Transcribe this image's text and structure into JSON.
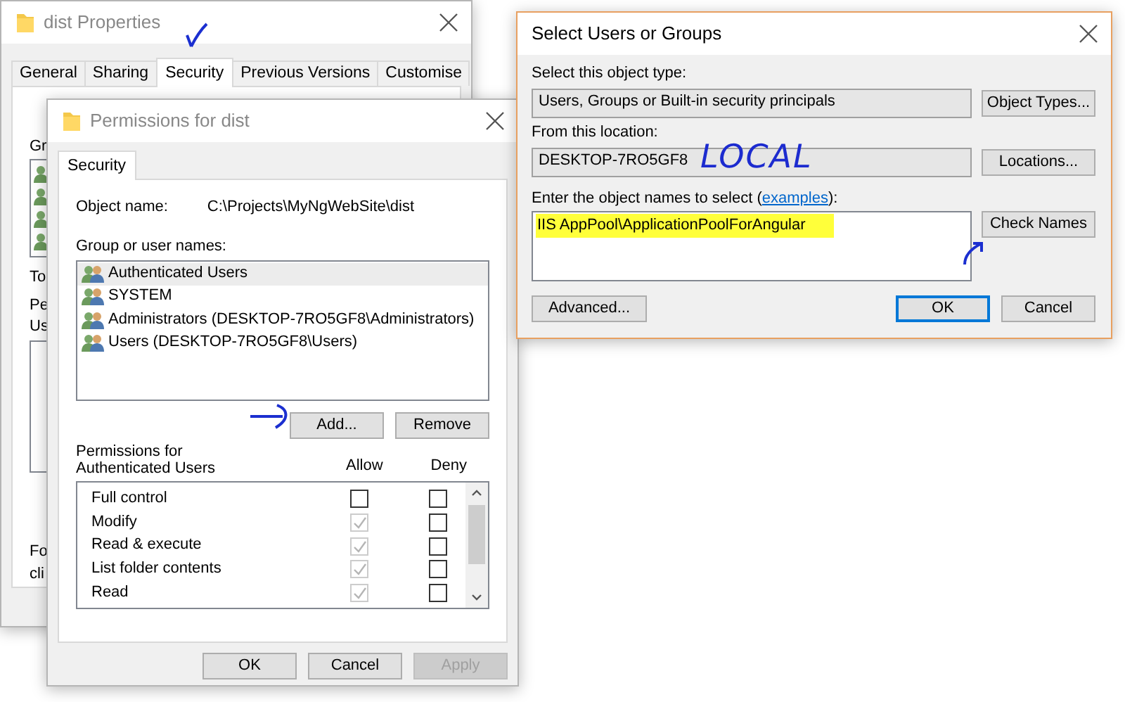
{
  "properties_window": {
    "title": "dist Properties",
    "tabs": [
      {
        "label": "General",
        "selected": false
      },
      {
        "label": "Sharing",
        "selected": false
      },
      {
        "label": "Security",
        "selected": true
      },
      {
        "label": "Previous Versions",
        "selected": false
      },
      {
        "label": "Customise",
        "selected": false
      }
    ],
    "partial_labels": [
      "Gr",
      "To",
      "Pe",
      "Us",
      "Fo",
      "cli"
    ]
  },
  "permissions_window": {
    "title": "Permissions for dist",
    "tabs": [
      {
        "label": "Security",
        "selected": true
      }
    ],
    "object_name_label": "Object name:",
    "object_name": "C:\\Projects\\MyNgWebSite\\dist",
    "group_label": "Group or user names:",
    "users": [
      {
        "name": "Authenticated Users",
        "selected": true
      },
      {
        "name": "SYSTEM",
        "selected": false
      },
      {
        "name": "Administrators (DESKTOP-7RO5GF8\\Administrators)",
        "selected": false
      },
      {
        "name": "Users (DESKTOP-7RO5GF8\\Users)",
        "selected": false
      }
    ],
    "user_buttons": [
      "Add...",
      "Remove"
    ],
    "permissions_label": "Permissions for Authenticated Users",
    "allow_header": "Allow",
    "deny_header": "Deny",
    "permissions": [
      {
        "name": "Full control",
        "allow": false,
        "allow_disabled": false,
        "deny": false
      },
      {
        "name": "Modify",
        "allow": true,
        "allow_disabled": true,
        "deny": false
      },
      {
        "name": "Read & execute",
        "allow": true,
        "allow_disabled": true,
        "deny": false
      },
      {
        "name": "List folder contents",
        "allow": true,
        "allow_disabled": true,
        "deny": false
      },
      {
        "name": "Read",
        "allow": true,
        "allow_disabled": true,
        "deny": false
      }
    ],
    "footer_buttons": [
      {
        "label": "OK",
        "disabled": false
      },
      {
        "label": "Cancel",
        "disabled": false
      },
      {
        "label": "Apply",
        "disabled": true
      }
    ]
  },
  "select_window": {
    "title": "Select Users or Groups",
    "object_type_label": "Select this object type:",
    "object_type": "Users, Groups or Built-in security principals",
    "object_types_button": "Object Types...",
    "location_label": "From this location:",
    "location": "DESKTOP-7RO5GF8",
    "locations_button": "Locations...",
    "names_label_before": "Enter the object names to select (",
    "examples_link": "examples",
    "names_label_after": "):",
    "names_value": "IIS AppPool\\ApplicationPoolForAngular",
    "names_highlighted": true,
    "check_names_button": "Check Names",
    "footer_buttons": [
      {
        "label": "Advanced...",
        "default": false
      },
      {
        "label": "OK",
        "default": true
      },
      {
        "label": "Cancel",
        "default": false
      }
    ]
  },
  "annotations": {
    "location_note": "LOCAL"
  }
}
